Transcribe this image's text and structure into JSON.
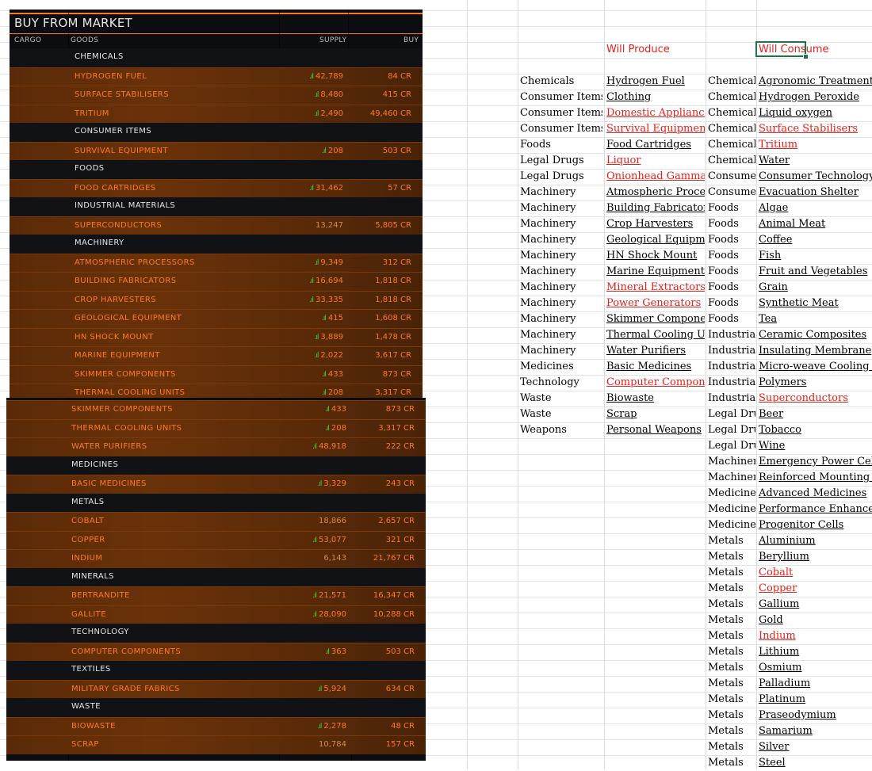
{
  "market": {
    "title": "BUY FROM MARKET",
    "columns": {
      "cargo": "CARGO",
      "goods": "GOODS",
      "supply": "SUPPLY",
      "buy": "BUY"
    },
    "top_rows": [
      {
        "type": "category",
        "name": "CHEMICALS"
      },
      {
        "type": "item",
        "name": "HYDROGEN FUEL",
        "supply": "42,789",
        "buy": "84 CR",
        "signal": true
      },
      {
        "type": "item",
        "name": "SURFACE STABILISERS",
        "supply": "8,480",
        "buy": "415 CR",
        "signal": true
      },
      {
        "type": "item",
        "name": "TRITIUM",
        "supply": "2,490",
        "buy": "49,460 CR",
        "signal": true
      },
      {
        "type": "category",
        "name": "CONSUMER ITEMS"
      },
      {
        "type": "item",
        "name": "SURVIVAL EQUIPMENT",
        "supply": "208",
        "buy": "503 CR",
        "signal": true
      },
      {
        "type": "category",
        "name": "FOODS"
      },
      {
        "type": "item",
        "name": "FOOD CARTRIDGES",
        "supply": "31,462",
        "buy": "57 CR",
        "signal": true
      },
      {
        "type": "category",
        "name": "INDUSTRIAL MATERIALS"
      },
      {
        "type": "item",
        "name": "SUPERCONDUCTORS",
        "supply": "13,247",
        "buy": "5,805 CR",
        "signal": false
      },
      {
        "type": "category",
        "name": "MACHINERY"
      },
      {
        "type": "item",
        "name": "ATMOSPHERIC PROCESSORS",
        "supply": "9,349",
        "buy": "312 CR",
        "signal": true
      },
      {
        "type": "item",
        "name": "BUILDING FABRICATORS",
        "supply": "16,694",
        "buy": "1,818 CR",
        "signal": true
      },
      {
        "type": "item",
        "name": "CROP HARVESTERS",
        "supply": "33,335",
        "buy": "1,818 CR",
        "signal": true
      },
      {
        "type": "item",
        "name": "GEOLOGICAL EQUIPMENT",
        "supply": "415",
        "buy": "1,608 CR",
        "signal": true
      },
      {
        "type": "item",
        "name": "HN SHOCK MOUNT",
        "supply": "3,889",
        "buy": "1,478 CR",
        "signal": true
      },
      {
        "type": "item",
        "name": "MARINE EQUIPMENT",
        "supply": "2,022",
        "buy": "3,617 CR",
        "signal": true
      },
      {
        "type": "item",
        "name": "SKIMMER COMPONENTS",
        "supply": "433",
        "buy": "873 CR",
        "signal": true
      },
      {
        "type": "item",
        "name": "THERMAL COOLING UNITS",
        "supply": "208",
        "buy": "3,317 CR",
        "signal": true
      }
    ],
    "bottom_rows": [
      {
        "type": "item",
        "name": "SKIMMER COMPONENTS",
        "supply": "433",
        "buy": "873 CR",
        "signal": true
      },
      {
        "type": "item",
        "name": "THERMAL COOLING UNITS",
        "supply": "208",
        "buy": "3,317 CR",
        "signal": true
      },
      {
        "type": "item",
        "name": "WATER PURIFIERS",
        "supply": "48,918",
        "buy": "222 CR",
        "signal": true
      },
      {
        "type": "category",
        "name": "MEDICINES"
      },
      {
        "type": "item",
        "name": "BASIC MEDICINES",
        "supply": "3,329",
        "buy": "243 CR",
        "signal": true
      },
      {
        "type": "category",
        "name": "METALS"
      },
      {
        "type": "item",
        "name": "COBALT",
        "supply": "18,866",
        "buy": "2,657 CR",
        "signal": false
      },
      {
        "type": "item",
        "name": "COPPER",
        "supply": "53,077",
        "buy": "321 CR",
        "signal": true
      },
      {
        "type": "item",
        "name": "INDIUM",
        "supply": "6,143",
        "buy": "21,767 CR",
        "signal": false
      },
      {
        "type": "category",
        "name": "MINERALS"
      },
      {
        "type": "item",
        "name": "BERTRANDITE",
        "supply": "21,571",
        "buy": "16,347 CR",
        "signal": true
      },
      {
        "type": "item",
        "name": "GALLITE",
        "supply": "28,090",
        "buy": "10,288 CR",
        "signal": true
      },
      {
        "type": "category",
        "name": "TECHNOLOGY"
      },
      {
        "type": "item",
        "name": "COMPUTER COMPONENTS",
        "supply": "363",
        "buy": "503 CR",
        "signal": true
      },
      {
        "type": "category",
        "name": "TEXTILES"
      },
      {
        "type": "item",
        "name": "MILITARY GRADE FABRICS",
        "supply": "5,924",
        "buy": "634 CR",
        "signal": true
      },
      {
        "type": "category",
        "name": "WASTE"
      },
      {
        "type": "item",
        "name": "BIOWASTE",
        "supply": "2,278",
        "buy": "48 CR",
        "signal": true
      },
      {
        "type": "item",
        "name": "SCRAP",
        "supply": "10,784",
        "buy": "157 CR",
        "signal": false
      }
    ]
  },
  "sheet": {
    "headers": {
      "produce": "Will Produce",
      "consume": "Will Consume"
    },
    "produce": [
      {
        "cat": "Chemicals",
        "item": "Hydrogen Fuel",
        "red": false
      },
      {
        "cat": "Consumer Items",
        "item": "Clothing",
        "red": false
      },
      {
        "cat": "Consumer Items",
        "item": "Domestic Appliances",
        "red": true
      },
      {
        "cat": "Consumer Items",
        "item": "Survival Equipment",
        "red": true
      },
      {
        "cat": "Foods",
        "item": "Food Cartridges",
        "red": false
      },
      {
        "cat": "Legal Drugs",
        "item": "Liquor",
        "red": true
      },
      {
        "cat": "Legal Drugs",
        "item": "Onionhead Gamma S",
        "red": true
      },
      {
        "cat": "Machinery",
        "item": "Atmospheric Process",
        "red": false
      },
      {
        "cat": "Machinery",
        "item": "Building Fabricators",
        "red": false
      },
      {
        "cat": "Machinery",
        "item": "Crop Harvesters",
        "red": false
      },
      {
        "cat": "Machinery",
        "item": "Geological Equipme",
        "red": false
      },
      {
        "cat": "Machinery",
        "item": "HN Shock Mount",
        "red": false
      },
      {
        "cat": "Machinery",
        "item": "Marine Equipment",
        "red": false
      },
      {
        "cat": "Machinery",
        "item": "Mineral Extractors",
        "red": true
      },
      {
        "cat": "Machinery",
        "item": "Power Generators",
        "red": true
      },
      {
        "cat": "Machinery",
        "item": "Skimmer Componen",
        "red": false
      },
      {
        "cat": "Machinery",
        "item": "Thermal Cooling Uni",
        "red": false
      },
      {
        "cat": "Machinery",
        "item": "Water Purifiers",
        "red": false
      },
      {
        "cat": "Medicines",
        "item": "Basic Medicines",
        "red": false
      },
      {
        "cat": "Technology",
        "item": "Computer Compone",
        "red": true
      },
      {
        "cat": "Waste",
        "item": "Biowaste",
        "red": false
      },
      {
        "cat": "Waste",
        "item": "Scrap",
        "red": false
      },
      {
        "cat": "Weapons",
        "item": "Personal Weapons",
        "red": false
      }
    ],
    "consume": [
      {
        "cat": "Chemicals",
        "item": "Agronomic Treatment",
        "red": false
      },
      {
        "cat": "Chemicals",
        "item": "Hydrogen Peroxide",
        "red": false
      },
      {
        "cat": "Chemicals",
        "item": "Liquid oxygen",
        "red": false
      },
      {
        "cat": "Chemicals",
        "item": "Surface Stabilisers",
        "red": true
      },
      {
        "cat": "Chemicals",
        "item": "Tritium",
        "red": true
      },
      {
        "cat": "Chemicals",
        "item": "Water",
        "red": false
      },
      {
        "cat": "Consumer",
        "item": "Consumer Technology",
        "red": false
      },
      {
        "cat": "Consumer",
        "item": "Evacuation Shelter",
        "red": false
      },
      {
        "cat": "Foods",
        "item": "Algae",
        "red": false
      },
      {
        "cat": "Foods",
        "item": "Animal Meat",
        "red": false
      },
      {
        "cat": "Foods",
        "item": "Coffee",
        "red": false
      },
      {
        "cat": "Foods",
        "item": "Fish",
        "red": false
      },
      {
        "cat": "Foods",
        "item": "Fruit and Vegetables",
        "red": false
      },
      {
        "cat": "Foods",
        "item": "Grain",
        "red": false
      },
      {
        "cat": "Foods",
        "item": "Synthetic Meat",
        "red": false
      },
      {
        "cat": "Foods",
        "item": "Tea",
        "red": false
      },
      {
        "cat": "Industrial",
        "item": "Ceramic Composites",
        "red": false
      },
      {
        "cat": "Industrial",
        "item": "Insulating Membrane",
        "red": false
      },
      {
        "cat": "Industrial",
        "item": "Micro-weave Cooling H",
        "red": false
      },
      {
        "cat": "Industrial",
        "item": "Polymers",
        "red": false
      },
      {
        "cat": "Industrial",
        "item": "Superconductors",
        "red": true
      },
      {
        "cat": "Legal Drug",
        "item": "Beer",
        "red": false
      },
      {
        "cat": "Legal Drug",
        "item": "Tobacco",
        "red": false
      },
      {
        "cat": "Legal Drug",
        "item": "Wine",
        "red": false
      },
      {
        "cat": "Machinery",
        "item": "Emergency Power Cells",
        "red": false
      },
      {
        "cat": "Machinery",
        "item": "Reinforced Mounting P",
        "red": false
      },
      {
        "cat": "Medicines",
        "item": "Advanced Medicines",
        "red": false
      },
      {
        "cat": "Medicines",
        "item": "Performance Enhancers",
        "red": false
      },
      {
        "cat": "Medicines",
        "item": "Progenitor Cells",
        "red": false
      },
      {
        "cat": "Metals",
        "item": "Aluminium",
        "red": false
      },
      {
        "cat": "Metals",
        "item": "Beryllium",
        "red": false
      },
      {
        "cat": "Metals",
        "item": "Cobalt",
        "red": true
      },
      {
        "cat": "Metals",
        "item": "Copper",
        "red": true
      },
      {
        "cat": "Metals",
        "item": "Gallium",
        "red": false
      },
      {
        "cat": "Metals",
        "item": "Gold",
        "red": false
      },
      {
        "cat": "Metals",
        "item": "Indium",
        "red": true
      },
      {
        "cat": "Metals",
        "item": "Lithium",
        "red": false
      },
      {
        "cat": "Metals",
        "item": "Osmium",
        "red": false
      },
      {
        "cat": "Metals",
        "item": "Palladium",
        "red": false
      },
      {
        "cat": "Metals",
        "item": "Platinum",
        "red": false
      },
      {
        "cat": "Metals",
        "item": "Praseodymium",
        "red": false
      },
      {
        "cat": "Metals",
        "item": "Samarium",
        "red": false
      },
      {
        "cat": "Metals",
        "item": "Silver",
        "red": false
      },
      {
        "cat": "Metals",
        "item": "Steel",
        "red": false
      }
    ]
  },
  "colors": {
    "accent": "#ff7a1f",
    "signal": "#3fcf3a",
    "sheet_red": "#e0221b",
    "selection": "#217346"
  }
}
